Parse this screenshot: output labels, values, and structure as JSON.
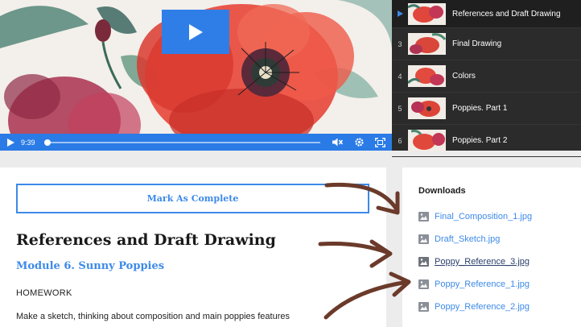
{
  "player": {
    "time": "9:39",
    "progress_fraction": 0.0
  },
  "playlist": {
    "items": [
      {
        "number": "",
        "title": "References and Draft Drawing",
        "active": true
      },
      {
        "number": "3",
        "title": "Final Drawing",
        "active": false
      },
      {
        "number": "4",
        "title": "Colors",
        "active": false
      },
      {
        "number": "5",
        "title": "Poppies. Part 1",
        "active": false
      },
      {
        "number": "6",
        "title": "Poppies. Part 2",
        "active": false
      }
    ]
  },
  "lesson": {
    "mark_complete_label": "Mark As Complete",
    "title": "References and Draft Drawing",
    "module": "Module 6. Sunny Poppies",
    "homework_heading": "HOMEWORK",
    "description": "Make a sketch, thinking about composition and main poppies features"
  },
  "downloads": {
    "heading": "Downloads",
    "files": [
      {
        "name": "Final_Composition_1.jpg",
        "visited": false
      },
      {
        "name": "Draft_Sketch.jpg",
        "visited": false
      },
      {
        "name": "Poppy_Reference_3.jpg",
        "visited": true
      },
      {
        "name": "Poppy_Reference_1.jpg",
        "visited": false
      },
      {
        "name": "Poppy_Reference_2.jpg",
        "visited": false
      }
    ]
  },
  "colors": {
    "accent": "#3d8ae8",
    "player_bar": "#2a7be6",
    "playlist_bg": "#2b2b2b",
    "arrow": "#6b3a2a"
  }
}
